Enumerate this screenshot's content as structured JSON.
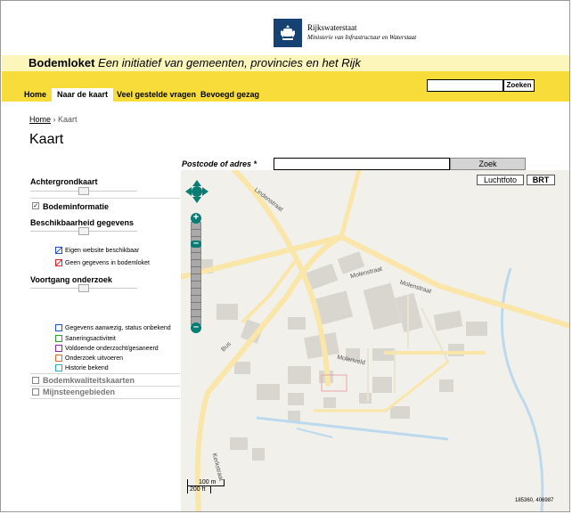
{
  "header": {
    "org_name": "Rijkswaterstaat",
    "org_sub": "Ministerie van Infrastructuur en Waterstaat"
  },
  "banner": {
    "site_name": "Bodemloket",
    "tagline": "Een initiatief van gemeenten, provincies en het Rijk"
  },
  "nav": {
    "items": [
      {
        "label": "Home"
      },
      {
        "label": "Naar de kaart"
      },
      {
        "label": "Veel gestelde vragen"
      },
      {
        "label": "Bevoegd gezag"
      }
    ],
    "active_index": 1,
    "search_value": "",
    "search_button": "Zoeken"
  },
  "breadcrumb": {
    "home": "Home",
    "separator": "›",
    "current": "Kaart"
  },
  "page_title": "Kaart",
  "postcode": {
    "label": "Postcode of adres",
    "required": "*",
    "value": "",
    "button": "Zoek"
  },
  "map_buttons": {
    "aerial": "Luchtfoto",
    "brt": "BRT"
  },
  "sidebar": {
    "background_map": "Achtergrondkaart",
    "bodeminformatie": "Bodeminformatie",
    "bodeminformatie_checked": true,
    "availability": "Beschikbaarheid gegevens",
    "availability_legend": [
      {
        "label": "Eigen website beschikbaar",
        "color": "#2050c8"
      },
      {
        "label": "Geen gegevens in bodemloket",
        "color": "#e0242b"
      }
    ],
    "progress": "Voortgang onderzoek",
    "progress_legend": [
      {
        "label": "Gegevens aanwezig, status onbekend",
        "color": "#2050c8"
      },
      {
        "label": "Saneringsactiviteit",
        "color": "#2aa02a"
      },
      {
        "label": "Voldoende onderzocht/gesaneerd",
        "color": "#8a2aa0"
      },
      {
        "label": "Onderzoek uitvoeren",
        "color": "#e0702a"
      },
      {
        "label": "Historie bekend",
        "color": "#2ab0c0"
      }
    ],
    "bodemkwaliteit": "Bodemkwaliteitskaarten",
    "bodemkwaliteit_checked": false,
    "mijnsteen": "Mijnsteengebieden",
    "mijnsteen_checked": false
  },
  "map": {
    "streets": [
      "Lindenstraat",
      "Molenstraat",
      "Molenstraat",
      "Molenveld",
      "Bus",
      "Kerkstraat"
    ],
    "scale_metric": "100 m",
    "scale_imperial": "200 ft",
    "coordinates": "185360, 406987"
  },
  "colors": {
    "banner_light": "#fdf6bb",
    "banner_yellow": "#f8dd3a",
    "zoom_teal": "#0a7c74",
    "road_yellow": "#f9e6a8",
    "water_blue": "#bcd9ee"
  }
}
